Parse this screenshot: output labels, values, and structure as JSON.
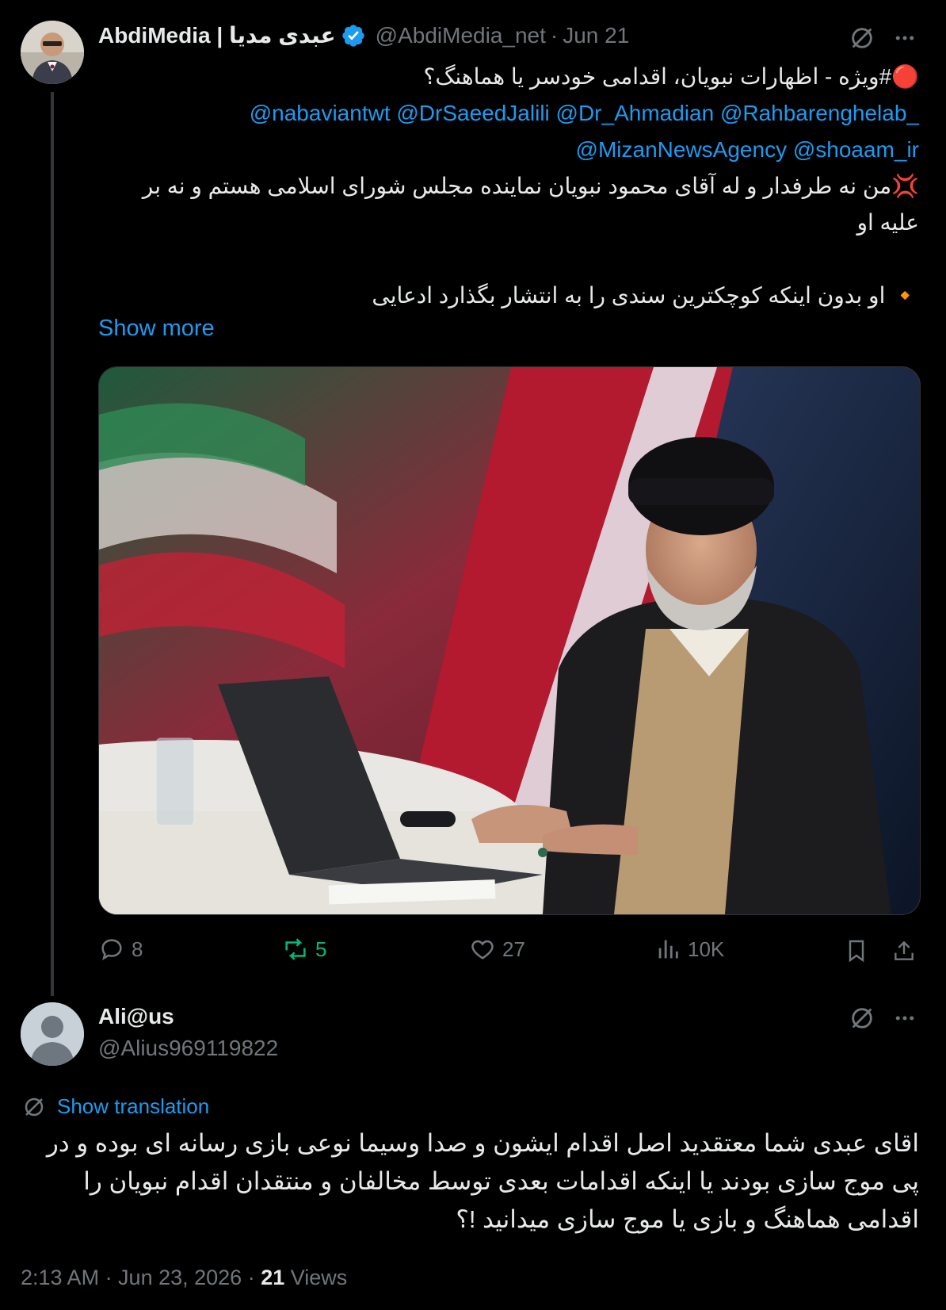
{
  "post": {
    "author_name": "AbdiMedia | عبدی مدیا",
    "handle": "@AbdiMedia_net",
    "separator": "·",
    "date": "Jun 21",
    "line1": "🔴#ویژه - اظهارات نبویان، اقدامی خودسر یا هماهنگ؟",
    "mentions_line1": "@nabaviantwt @DrSaeedJalili @Dr_Ahmadian @Rahbarenghelab_",
    "mentions_line2": "@MizanNewsAgency @shoaam_ir",
    "line4": "💢من نه طرفدار و له آقای محمود نبویان نماینده مجلس شورای اسلامی هستم و نه بر علیه او",
    "line5": "🔸 او بدون اینکه کوچکترین سندی را به انتشار بگذارد ادعایی",
    "show_more": "Show more",
    "replies": "8",
    "reposts": "5",
    "likes": "27",
    "views": "10K"
  },
  "reply": {
    "author_name": "Ali@us",
    "handle": "@Alius969119822",
    "show_translation": "Show translation",
    "text": "اقای عبدی شما معتقدید اصل اقدام ایشون و صدا وسیما نوعی بازی رسانه ای بوده و در پی موج سازی بودند یا اینکه اقدامات بعدی توسط مخالفان و منتقدان اقدام نبویان را اقدامی هماهنگ و بازی یا موج سازی میدانید !؟",
    "time": "2:13 AM · Jun 23, 2026 ·",
    "views_count": "21",
    "views_label": "Views"
  },
  "colors": {
    "link": "#1d9bf0",
    "muted": "#71767b",
    "repost_active": "#00ba7c",
    "verified": "#1d9bf0"
  },
  "icons": [
    "grok-icon",
    "more-icon",
    "verified-badge-icon",
    "reply-icon",
    "repost-icon",
    "like-icon",
    "views-icon",
    "bookmark-icon",
    "share-icon",
    "translate-icon"
  ]
}
